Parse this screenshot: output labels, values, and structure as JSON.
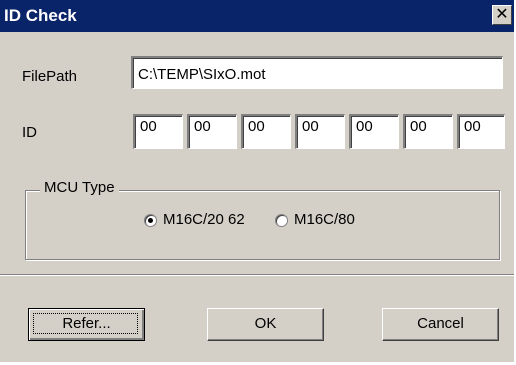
{
  "window": {
    "title": "ID Check",
    "close_glyph": "✕"
  },
  "filepath": {
    "label": "FilePath",
    "value": "C:\\TEMP\\SIxO.mot"
  },
  "id": {
    "label": "ID",
    "values": [
      "00",
      "00",
      "00",
      "00",
      "00",
      "00",
      "00"
    ]
  },
  "mcu": {
    "group_label": "MCU Type",
    "options": [
      {
        "label": "M16C/20 62",
        "selected": true
      },
      {
        "label": "M16C/80",
        "selected": false
      }
    ]
  },
  "buttons": {
    "refer": "Refer...",
    "ok": "OK",
    "cancel": "Cancel"
  }
}
